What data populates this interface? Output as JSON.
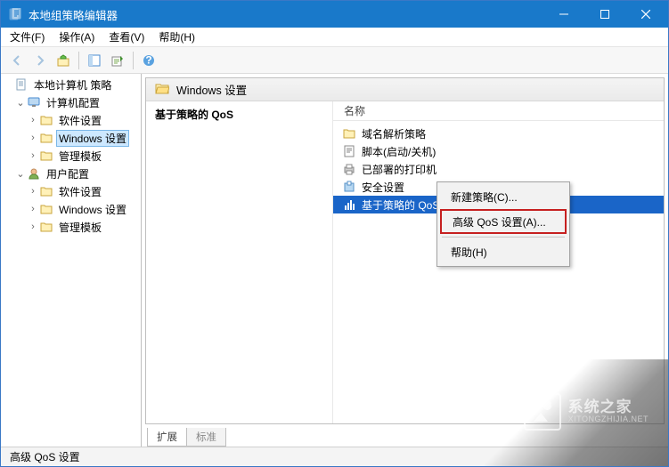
{
  "window": {
    "title": "本地组策略编辑器"
  },
  "menu": {
    "file": "文件(F)",
    "action": "操作(A)",
    "view": "查看(V)",
    "help": "帮助(H)"
  },
  "tree": {
    "root": "本地计算机 策略",
    "computer": "计算机配置",
    "software1": "软件设置",
    "winSettings1": "Windows 设置",
    "adminTpl1": "管理模板",
    "user": "用户配置",
    "software2": "软件设置",
    "winSettings2": "Windows 设置",
    "adminTpl2": "管理模板"
  },
  "content": {
    "headerTitle": "Windows 设置",
    "detailCaption": "基于策略的 QoS",
    "columnHeader": "名称",
    "items": {
      "dns": "域名解析策略",
      "scripts": "脚本(启动/关机)",
      "printers": "已部署的打印机",
      "security": "安全设置",
      "qos": "基于策略的 QoS"
    }
  },
  "context": {
    "newPolicy": "新建策略(C)...",
    "advanced": "高级 QoS 设置(A)...",
    "help": "帮助(H)"
  },
  "footerTabs": {
    "extended": "扩展",
    "standard": "标准"
  },
  "status": "高级 QoS 设置",
  "watermark": {
    "cn": "系统之家",
    "en": "XITONGZHIJIA.NET"
  }
}
